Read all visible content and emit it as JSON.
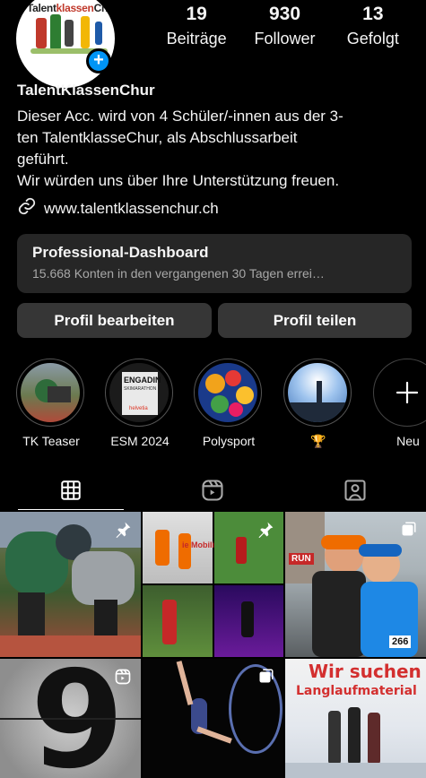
{
  "profile": {
    "logo_text_a": "Talent",
    "logo_text_b": "klassen",
    "logo_text_c": "Chur",
    "name": "TalentKlassenChur",
    "bio_lines": [
      "Dieser Acc. wird von 4 Schüler/-innen aus der 3-",
      "ten TalentklasseChur, als Abschlussarbeit",
      "geführt.",
      "Wir würden uns über Ihre Unterstützung freuen."
    ],
    "link": "www.talentklassenchur.ch"
  },
  "stats": [
    {
      "num": "19",
      "label": "Beiträge"
    },
    {
      "num": "930",
      "label": "Follower"
    },
    {
      "num": "13",
      "label": "Gefolgt"
    }
  ],
  "dashboard": {
    "title": "Professional-Dashboard",
    "subtitle": "15.668 Konten in den vergangenen 30 Tagen errei…"
  },
  "buttons": {
    "edit": "Profil bearbeiten",
    "share": "Profil teilen"
  },
  "highlights": [
    {
      "label": "TK Teaser"
    },
    {
      "label": "ESM 2024",
      "inner_text_1": "ENGADIN",
      "inner_text_2": "SKIMARATHON",
      "inner_text_3": "helvetia"
    },
    {
      "label": "Polysport"
    },
    {
      "label": "🏆"
    },
    {
      "label": "Neu"
    }
  ],
  "posts": {
    "p3_banner": "RUN",
    "p3_bib": "266",
    "p4_number": "9",
    "p6_line1": "Wir suchen",
    "p6_line2": "Langlaufmaterial",
    "p2_adboard": "ie Mobili"
  },
  "colors": {
    "accent_blue": "#0095f6",
    "button_bg": "#363636",
    "card_bg": "#262626"
  }
}
